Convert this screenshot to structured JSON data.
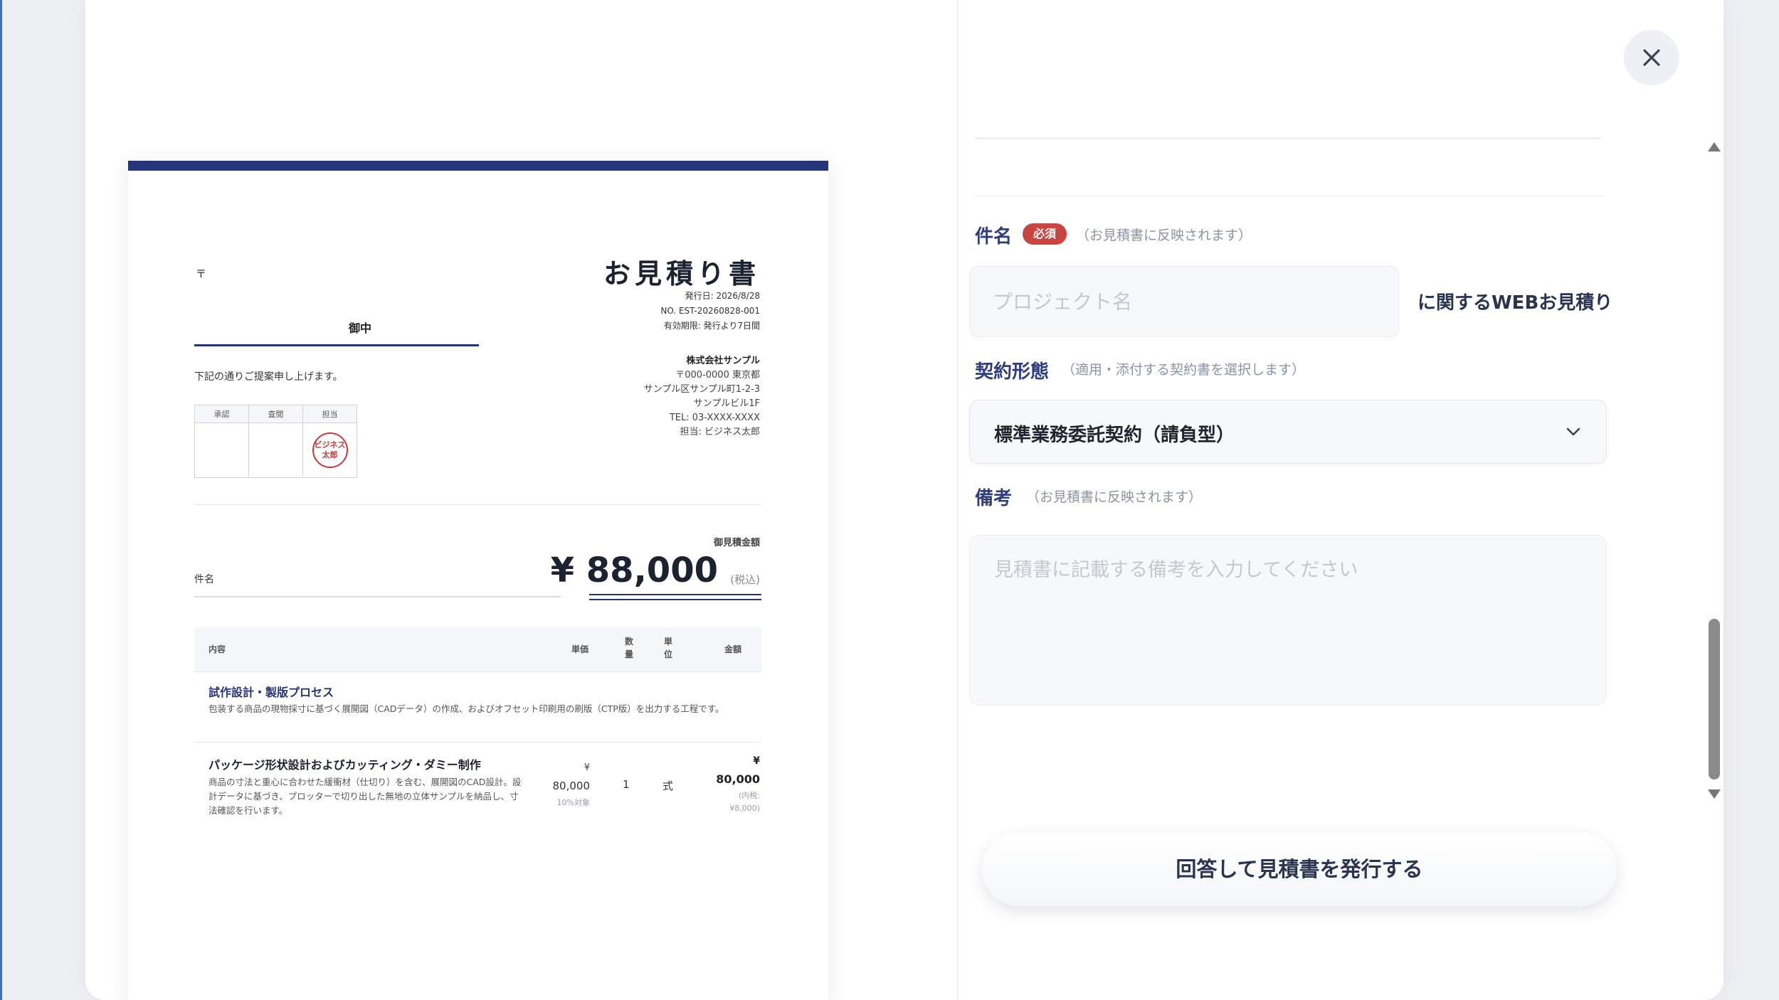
{
  "close_button": {
    "label": "×",
    "icon": "close-icon"
  },
  "document": {
    "postal_mark": "〒",
    "addressee_suffix": "御中",
    "title": "お見積り書",
    "meta": {
      "issue_date": "発行日: 2026/8/28",
      "number": "NO. EST-20260828-001",
      "validity": "有効期限: 発行より7日間"
    },
    "intro": "下記の通りご提案申し上げます。",
    "company": {
      "name": "株式会社サンプル",
      "address_line1": "〒000-0000 東京都",
      "address_line2": "サンプル区サンプル町1-2-3",
      "address_line3": "サンプルビル1F",
      "tel": "TEL: 03-XXXX-XXXX",
      "contact": "担当: ビジネス太郎"
    },
    "approval": {
      "headers": [
        "承認",
        "査閲",
        "担当"
      ],
      "stamp_text": "ビジネス太郎",
      "stamp_line1": "ビジネス",
      "stamp_line2": "太郎"
    },
    "amount_label": "御見積金額",
    "subject_label": "件名",
    "total": "¥ 88,000",
    "tax_note": "(税込)",
    "table_headers": {
      "content": "内容",
      "unit_price": "単価",
      "qty": "数量",
      "qty_l1": "数",
      "qty_l2": "量",
      "uom": "単位",
      "uom_l1": "単",
      "uom_l2": "位",
      "amount": "金額"
    },
    "items": [
      {
        "title": "試作設計・製版プロセス",
        "desc": "包装する商品の現物採寸に基づく展開図（CADデータ）の作成、およびオフセット印刷用の刷版（CTP版）を出力する工程です。"
      },
      {
        "title": "パッケージ形状設計およびカッティング・ダミー制作",
        "desc": "商品の寸法と重心に合わせた緩衝材（仕切り）を含む、展開図のCAD設計。設計データに基づき、プロッターで切り出した無地の立体サンプルを納品し、寸法確認を行います。",
        "unit_price_yen": "¥",
        "unit_price": "80,000",
        "unit_note": "10%対象",
        "qty": "1",
        "uom": "式",
        "amount_yen": "¥",
        "amount": "80,000",
        "amount_note_l1": "(内税:",
        "amount_note_l2": "¥8,000)"
      }
    ]
  },
  "form": {
    "subject": {
      "label": "件名",
      "required_badge": "必須",
      "hint": "（お見積書に反映されます）",
      "placeholder": "プロジェクト名",
      "value": "",
      "suffix": "に関するWEBお見積り"
    },
    "contract": {
      "label": "契約形態",
      "hint": "（適用・添付する契約書を選択します）",
      "selected": "標準業務委託契約（請負型）"
    },
    "notes": {
      "label": "備考",
      "hint": "（お見積書に反映されます）",
      "placeholder": "見積書に記載する備考を入力してください",
      "value": ""
    },
    "submit_label": "回答して見積書を発行する"
  },
  "scrollbar": {
    "position": 0.85
  },
  "colors": {
    "accent": "#26357a",
    "required": "#c9453f",
    "label": "#2d3d7e"
  }
}
